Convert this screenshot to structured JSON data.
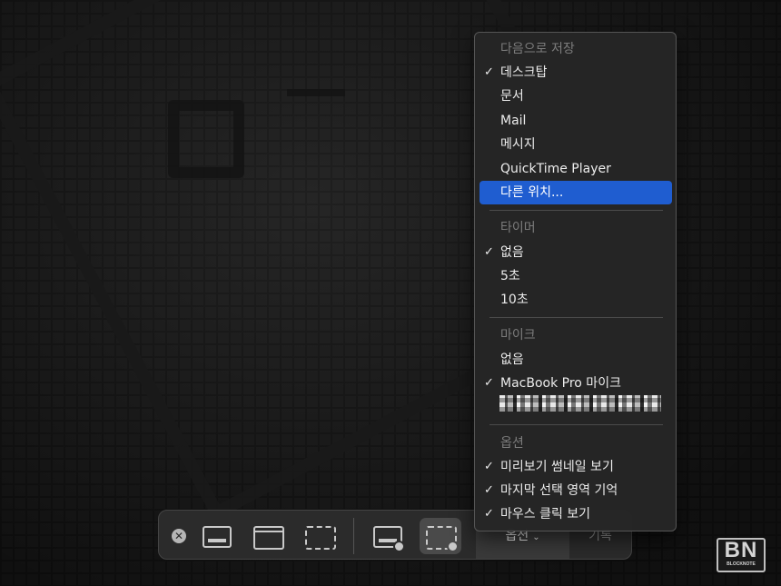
{
  "toolbar": {
    "close_symbol": "✕",
    "buttons": [
      {
        "id": "capture-entire-screen",
        "icon": "screen-capture-icon"
      },
      {
        "id": "capture-window",
        "icon": "window-capture-icon"
      },
      {
        "id": "capture-selection",
        "icon": "selection-capture-icon"
      },
      {
        "id": "record-entire-screen",
        "icon": "screen-record-icon"
      },
      {
        "id": "record-selection",
        "icon": "selection-record-icon",
        "selected": true
      }
    ],
    "options_label": "옵션",
    "options_chevron": "⌄",
    "record_label": "기록"
  },
  "menu": {
    "sections": [
      {
        "header": "다음으로 저장",
        "items": [
          {
            "label": "데스크탑",
            "checked": true
          },
          {
            "label": "문서",
            "checked": false
          },
          {
            "label": "Mail",
            "checked": false
          },
          {
            "label": "메시지",
            "checked": false
          },
          {
            "label": "QuickTime Player",
            "checked": false
          },
          {
            "label": "다른 위치...",
            "checked": false,
            "highlighted": true
          }
        ]
      },
      {
        "header": "타이머",
        "items": [
          {
            "label": "없음",
            "checked": true
          },
          {
            "label": "5초",
            "checked": false
          },
          {
            "label": "10초",
            "checked": false
          }
        ]
      },
      {
        "header": "마이크",
        "items": [
          {
            "label": "없음",
            "checked": false
          },
          {
            "label": "MacBook Pro 마이크",
            "checked": true
          },
          {
            "label": "",
            "checked": false,
            "pixelated": true
          }
        ]
      },
      {
        "header": "옵션",
        "items": [
          {
            "label": "미리보기 썸네일 보기",
            "checked": true
          },
          {
            "label": "마지막 선택 영역 기억",
            "checked": true
          },
          {
            "label": "마우스 클릭 보기",
            "checked": true
          }
        ]
      }
    ],
    "check_symbol": "✓",
    "highlight_color": "#1f5dd0"
  },
  "logo": {
    "big": "BN",
    "small": "BLOCKNOTE"
  }
}
